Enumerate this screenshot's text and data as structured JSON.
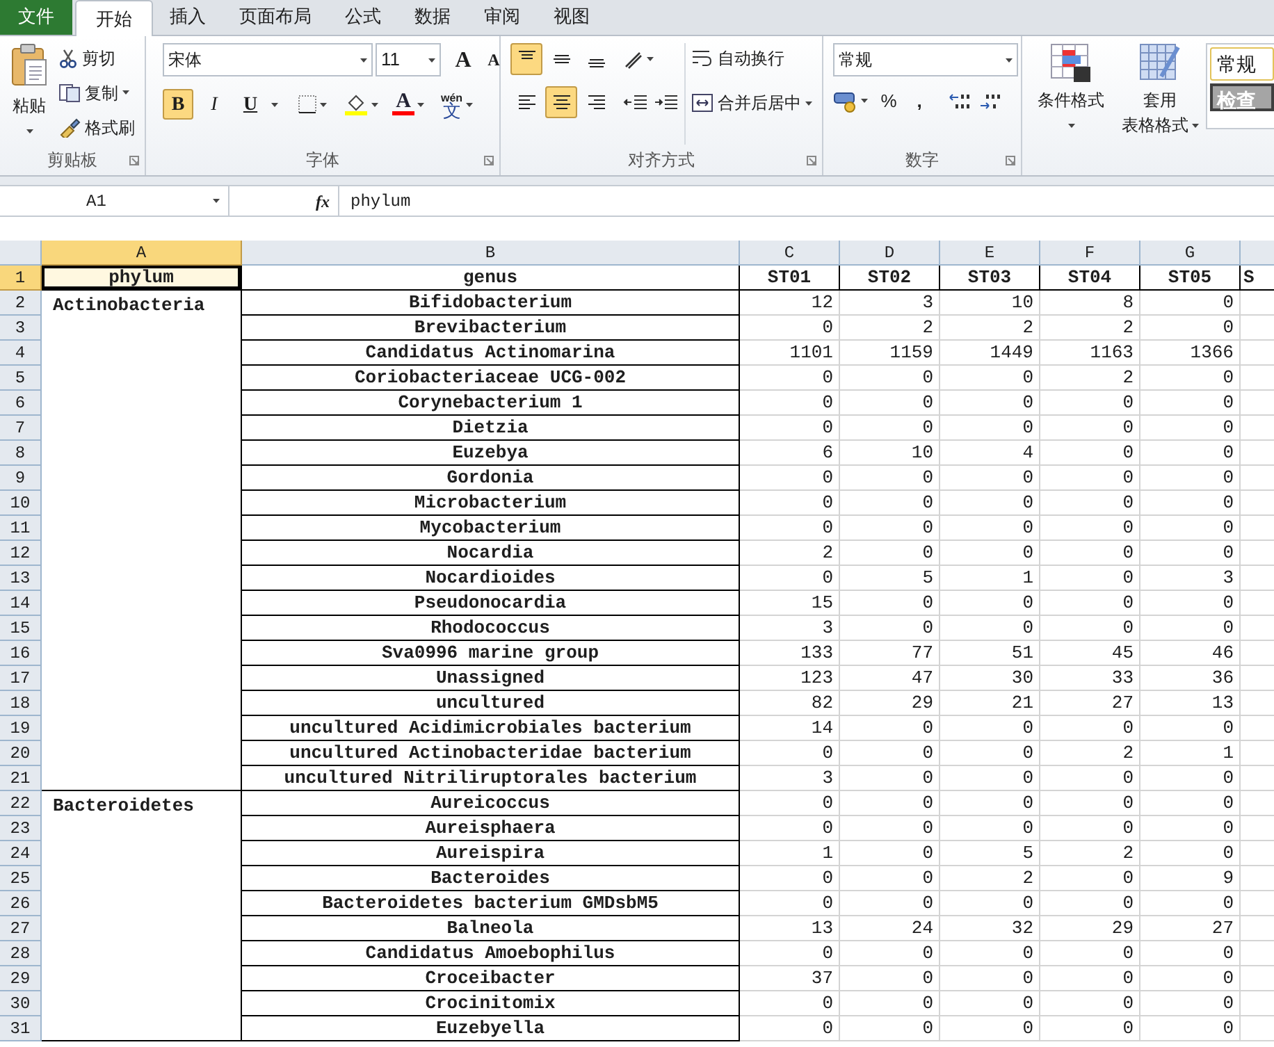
{
  "tabs": [
    {
      "label": "文件",
      "kind": "file",
      "selected": false
    },
    {
      "label": "开始",
      "kind": "tab",
      "selected": true
    },
    {
      "label": "插入",
      "kind": "tab",
      "selected": false
    },
    {
      "label": "页面布局",
      "kind": "tab",
      "selected": false
    },
    {
      "label": "公式",
      "kind": "tab",
      "selected": false
    },
    {
      "label": "数据",
      "kind": "tab",
      "selected": false
    },
    {
      "label": "审阅",
      "kind": "tab",
      "selected": false
    },
    {
      "label": "视图",
      "kind": "tab",
      "selected": false
    }
  ],
  "clipboard": {
    "label": "剪贴板",
    "paste": "粘贴",
    "cut": "剪切",
    "copy": "复制",
    "format_painter": "格式刷"
  },
  "font": {
    "label": "字体",
    "name": "宋体",
    "size": "11",
    "grow": "A",
    "shrink": "A",
    "font_color_glyph": "A",
    "phonetic_top": "wén",
    "phonetic": "文",
    "styles": [
      {
        "kind": "bold",
        "glyph": "B",
        "on": true
      },
      {
        "kind": "italic",
        "glyph": "I",
        "on": false
      },
      {
        "kind": "underline",
        "glyph": "U",
        "on": false
      }
    ]
  },
  "alignment": {
    "label": "对齐方式",
    "wrap": "自动换行",
    "merge": "合并后居中",
    "buttons": [
      {
        "kind": "top",
        "on": true
      },
      {
        "kind": "middle",
        "on": false
      },
      {
        "kind": "bottom",
        "on": false
      },
      {
        "kind": "left",
        "on": false
      },
      {
        "kind": "center",
        "on": true
      },
      {
        "kind": "right",
        "on": false
      }
    ]
  },
  "number": {
    "label": "数字",
    "format": "常规",
    "percent": "%",
    "comma": ","
  },
  "styles": {
    "conditional": "条件格式",
    "table_format_top": "套用",
    "table_format_bottom": "表格格式",
    "cell_styles": [
      {
        "label": "常规",
        "kind": "normal"
      },
      {
        "label": "检查",
        "kind": "check"
      }
    ]
  },
  "formula_bar": {
    "name_box": "A1",
    "fx": "fx",
    "formula": "phylum"
  },
  "sheet": {
    "columns": [
      {
        "label": "A",
        "selected": true
      },
      {
        "label": "B",
        "selected": false
      },
      {
        "label": "C",
        "selected": false
      },
      {
        "label": "D",
        "selected": false
      },
      {
        "label": "E",
        "selected": false
      },
      {
        "label": "F",
        "selected": false
      },
      {
        "label": "G",
        "selected": false
      }
    ],
    "header_row": {
      "row_number": "1",
      "selected": true,
      "cells": [
        {
          "text": "phylum",
          "selected": true
        },
        {
          "text": "genus",
          "selected": false
        },
        {
          "text": "ST01",
          "selected": false
        },
        {
          "text": "ST02",
          "selected": false
        },
        {
          "text": "ST03",
          "selected": false
        },
        {
          "text": "ST04",
          "selected": false
        },
        {
          "text": "ST05",
          "selected": false
        },
        {
          "text": "S",
          "selected": false
        }
      ]
    },
    "groups": [
      {
        "phylum": "Actinobacteria",
        "rows": [
          {
            "row_number": "2",
            "genus": "Bifidobacterium",
            "values": [
              "12",
              "3",
              "10",
              "8",
              "0"
            ]
          },
          {
            "row_number": "3",
            "genus": "Brevibacterium",
            "values": [
              "0",
              "2",
              "2",
              "2",
              "0"
            ]
          },
          {
            "row_number": "4",
            "genus": "Candidatus Actinomarina",
            "values": [
              "1101",
              "1159",
              "1449",
              "1163",
              "1366"
            ]
          },
          {
            "row_number": "5",
            "genus": "Coriobacteriaceae UCG-002",
            "values": [
              "0",
              "0",
              "0",
              "2",
              "0"
            ]
          },
          {
            "row_number": "6",
            "genus": "Corynebacterium 1",
            "values": [
              "0",
              "0",
              "0",
              "0",
              "0"
            ]
          },
          {
            "row_number": "7",
            "genus": "Dietzia",
            "values": [
              "0",
              "0",
              "0",
              "0",
              "0"
            ]
          },
          {
            "row_number": "8",
            "genus": "Euzebya",
            "values": [
              "6",
              "10",
              "4",
              "0",
              "0"
            ]
          },
          {
            "row_number": "9",
            "genus": "Gordonia",
            "values": [
              "0",
              "0",
              "0",
              "0",
              "0"
            ]
          },
          {
            "row_number": "10",
            "genus": "Microbacterium",
            "values": [
              "0",
              "0",
              "0",
              "0",
              "0"
            ]
          },
          {
            "row_number": "11",
            "genus": "Mycobacterium",
            "values": [
              "0",
              "0",
              "0",
              "0",
              "0"
            ]
          },
          {
            "row_number": "12",
            "genus": "Nocardia",
            "values": [
              "2",
              "0",
              "0",
              "0",
              "0"
            ]
          },
          {
            "row_number": "13",
            "genus": "Nocardioides",
            "values": [
              "0",
              "5",
              "1",
              "0",
              "3"
            ]
          },
          {
            "row_number": "14",
            "genus": "Pseudonocardia",
            "values": [
              "15",
              "0",
              "0",
              "0",
              "0"
            ]
          },
          {
            "row_number": "15",
            "genus": "Rhodococcus",
            "values": [
              "3",
              "0",
              "0",
              "0",
              "0"
            ]
          },
          {
            "row_number": "16",
            "genus": "Sva0996 marine group",
            "values": [
              "133",
              "77",
              "51",
              "45",
              "46"
            ]
          },
          {
            "row_number": "17",
            "genus": "Unassigned",
            "values": [
              "123",
              "47",
              "30",
              "33",
              "36"
            ]
          },
          {
            "row_number": "18",
            "genus": "uncultured",
            "values": [
              "82",
              "29",
              "21",
              "27",
              "13"
            ]
          },
          {
            "row_number": "19",
            "genus": "uncultured Acidimicrobiales bacterium",
            "values": [
              "14",
              "0",
              "0",
              "0",
              "0"
            ]
          },
          {
            "row_number": "20",
            "genus": "uncultured Actinobacteridae bacterium",
            "values": [
              "0",
              "0",
              "0",
              "2",
              "1"
            ]
          },
          {
            "row_number": "21",
            "genus": "uncultured Nitriliruptorales bacterium",
            "values": [
              "3",
              "0",
              "0",
              "0",
              "0"
            ]
          }
        ]
      },
      {
        "phylum": "Bacteroidetes",
        "rows": [
          {
            "row_number": "22",
            "genus": "Aureicoccus",
            "values": [
              "0",
              "0",
              "0",
              "0",
              "0"
            ]
          },
          {
            "row_number": "23",
            "genus": "Aureisphaera",
            "values": [
              "0",
              "0",
              "0",
              "0",
              "0"
            ]
          },
          {
            "row_number": "24",
            "genus": "Aureispira",
            "values": [
              "1",
              "0",
              "5",
              "2",
              "0"
            ]
          },
          {
            "row_number": "25",
            "genus": "Bacteroides",
            "values": [
              "0",
              "0",
              "2",
              "0",
              "9"
            ]
          },
          {
            "row_number": "26",
            "genus": "Bacteroidetes bacterium GMDsbM5",
            "values": [
              "0",
              "0",
              "0",
              "0",
              "0"
            ]
          },
          {
            "row_number": "27",
            "genus": "Balneola",
            "values": [
              "13",
              "24",
              "32",
              "29",
              "27"
            ]
          },
          {
            "row_number": "28",
            "genus": "Candidatus Amoebophilus",
            "values": [
              "0",
              "0",
              "0",
              "0",
              "0"
            ]
          },
          {
            "row_number": "29",
            "genus": "Croceibacter",
            "values": [
              "37",
              "0",
              "0",
              "0",
              "0"
            ]
          },
          {
            "row_number": "30",
            "genus": "Crocinitomix",
            "values": [
              "0",
              "0",
              "0",
              "0",
              "0"
            ]
          },
          {
            "row_number": "31",
            "genus": "Euzebyella",
            "values": [
              "0",
              "0",
              "0",
              "0",
              "0"
            ]
          }
        ]
      }
    ]
  }
}
